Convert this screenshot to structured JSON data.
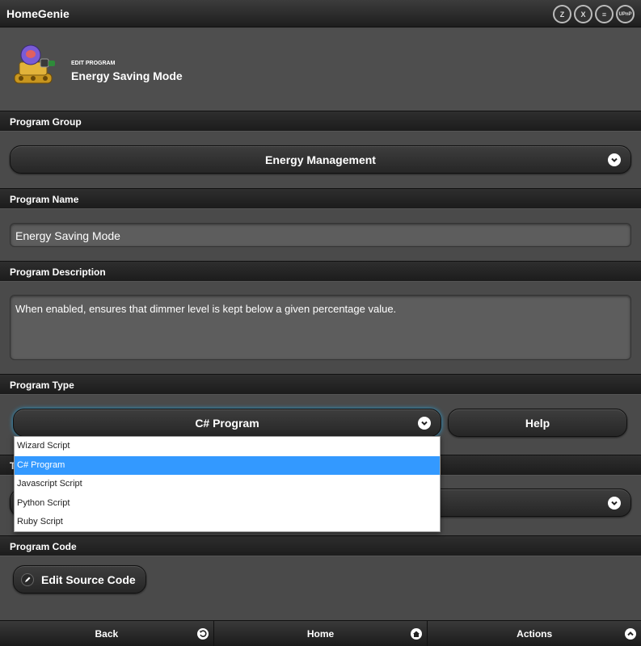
{
  "app": {
    "title": "HomeGenie"
  },
  "protocol_icons": [
    {
      "name": "zwave-icon",
      "glyph": "Z"
    },
    {
      "name": "x10-icon",
      "glyph": "X"
    },
    {
      "name": "insteon-icon",
      "glyph": "≡"
    },
    {
      "name": "upnp-icon",
      "glyph": "UPnP"
    }
  ],
  "header": {
    "caption": "EDIT PROGRAM",
    "title": "Energy Saving Mode"
  },
  "sections": {
    "group": "Program Group",
    "name": "Program Name",
    "description": "Program Description",
    "type": "Program Type",
    "target": "T",
    "code": "Program Code"
  },
  "program_group": {
    "value": "Energy Management"
  },
  "program_name": {
    "value": "Energy Saving Mode"
  },
  "program_description": {
    "value": "When enabled, ensures that dimmer level is kept below a given percentage value."
  },
  "program_type": {
    "value": "C# Program",
    "help_label": "Help",
    "options": [
      "Wizard Script",
      "C# Program",
      "Javascript Script",
      "Python Script",
      "Ruby Script"
    ],
    "selected_index": 1
  },
  "program_code": {
    "edit_label": "Edit Source Code"
  },
  "footer": {
    "back": "Back",
    "home": "Home",
    "actions": "Actions"
  }
}
